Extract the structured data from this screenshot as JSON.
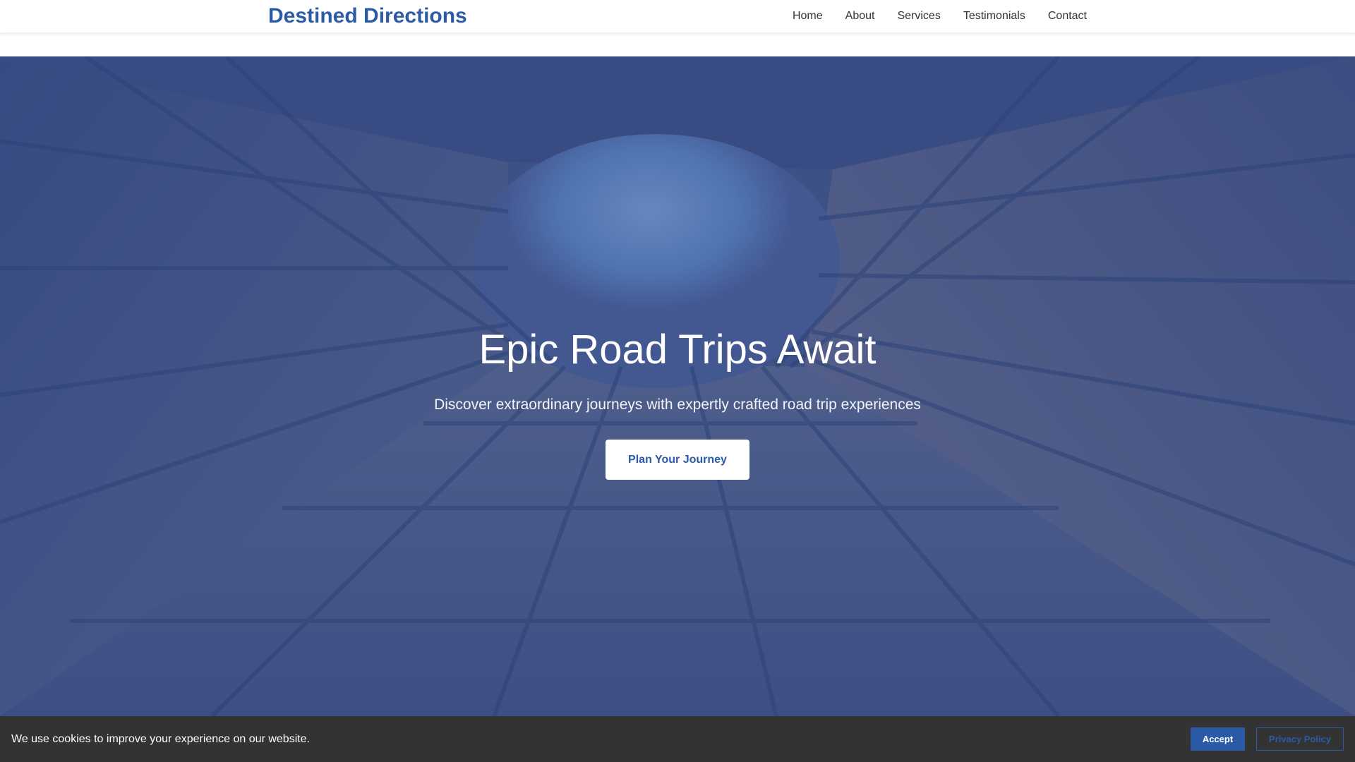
{
  "site": {
    "brand": "Destined Directions"
  },
  "nav": {
    "items": [
      {
        "label": "Home"
      },
      {
        "label": "About"
      },
      {
        "label": "Services"
      },
      {
        "label": "Testimonials"
      },
      {
        "label": "Contact"
      }
    ]
  },
  "hero": {
    "title": "Epic Road Trips Await",
    "subtitle": "Discover extraordinary journeys with expertly crafted road trip experiences",
    "cta_label": "Plan Your Journey"
  },
  "cookie": {
    "message": "We use cookies to improve your experience on our website.",
    "accept_label": "Accept",
    "privacy_label": "Privacy Policy"
  },
  "colors": {
    "brand": "#2b5aa6",
    "overlay": "#2b56a0",
    "cookie_bar": "#333333",
    "nav_text": "#333333"
  }
}
